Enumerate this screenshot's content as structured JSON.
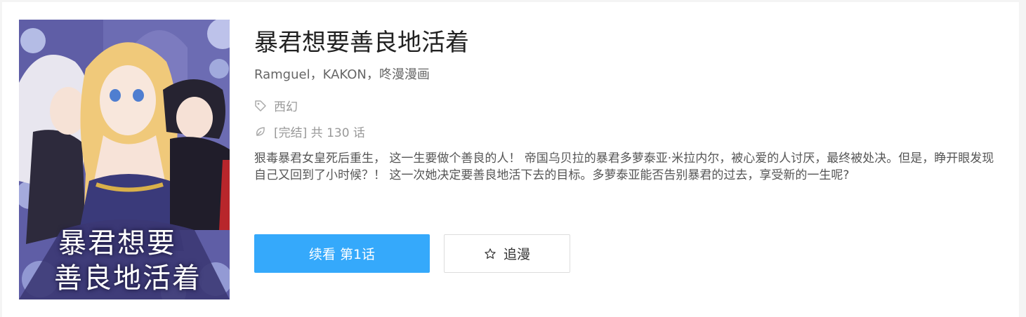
{
  "cover": {
    "title_line1": "暴君想要",
    "title_line2": "善良地活着"
  },
  "comic": {
    "title": "暴君想要善良地活着",
    "authors": "Ramguel，KAKON，咚漫漫画",
    "tag": "西幻",
    "status": "[完结] 共 130 话",
    "description": "狠毒暴君女皇死后重生， 这一生要做个善良的人！ 帝国乌贝拉的暴君多萝泰亚·米拉内尔，被心爱的人讨厌，最终被处决。但是，睁开眼发现自己又回到了小时候？！ 这一次她决定要善良地活下去的目标。多萝泰亚能否告别暴君的过去，享受新的一生呢?"
  },
  "actions": {
    "read_label": "续看 第1话",
    "follow_label": "追漫"
  },
  "icons": {
    "tag": "tag-icon",
    "status": "leaf-icon",
    "follow": "star-icon"
  },
  "colors": {
    "primary": "#35a9fb",
    "text_title": "#222222",
    "text_meta": "#999999"
  }
}
